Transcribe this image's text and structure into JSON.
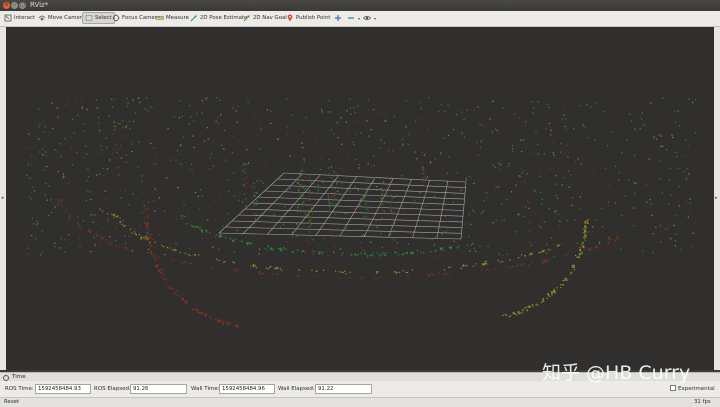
{
  "window": {
    "title": "RViz*"
  },
  "toolbar": {
    "tools": [
      {
        "label": "Interact",
        "icon": "interact-icon"
      },
      {
        "label": "Move Camera",
        "icon": "move-camera-icon"
      },
      {
        "label": "Select",
        "icon": "select-icon",
        "active": true
      },
      {
        "label": "Focus Camera",
        "icon": "focus-camera-icon"
      },
      {
        "label": "Measure",
        "icon": "measure-icon"
      },
      {
        "label": "2D Pose Estimate",
        "icon": "pose-arrow-icon"
      },
      {
        "label": "2D Nav Goal",
        "icon": "nav-goal-arrow-icon"
      },
      {
        "label": "Publish Point",
        "icon": "map-pin-icon"
      }
    ]
  },
  "time_panel": {
    "header": "Time",
    "ros_time_label": "ROS Time:",
    "ros_time_value": "1592458484.93",
    "ros_elapsed_label": "ROS Elapsed:",
    "ros_elapsed_value": "91.26",
    "wall_time_label": "Wall Time:",
    "wall_time_value": "1592458484.96",
    "wall_elapsed_label": "Wall Elapsed:",
    "wall_elapsed_value": "91.22",
    "experimental_label": "Experimental"
  },
  "status": {
    "reset_label": "Reset",
    "fps": "31 fps"
  },
  "watermark": "知乎 @HB Curry",
  "colors": {
    "viewport_bg": "#302f2d",
    "grid": "#a8a8a8",
    "points_green": "#2d8a3a",
    "points_red": "#8a3324",
    "points_yellow": "#9a8a2c"
  }
}
